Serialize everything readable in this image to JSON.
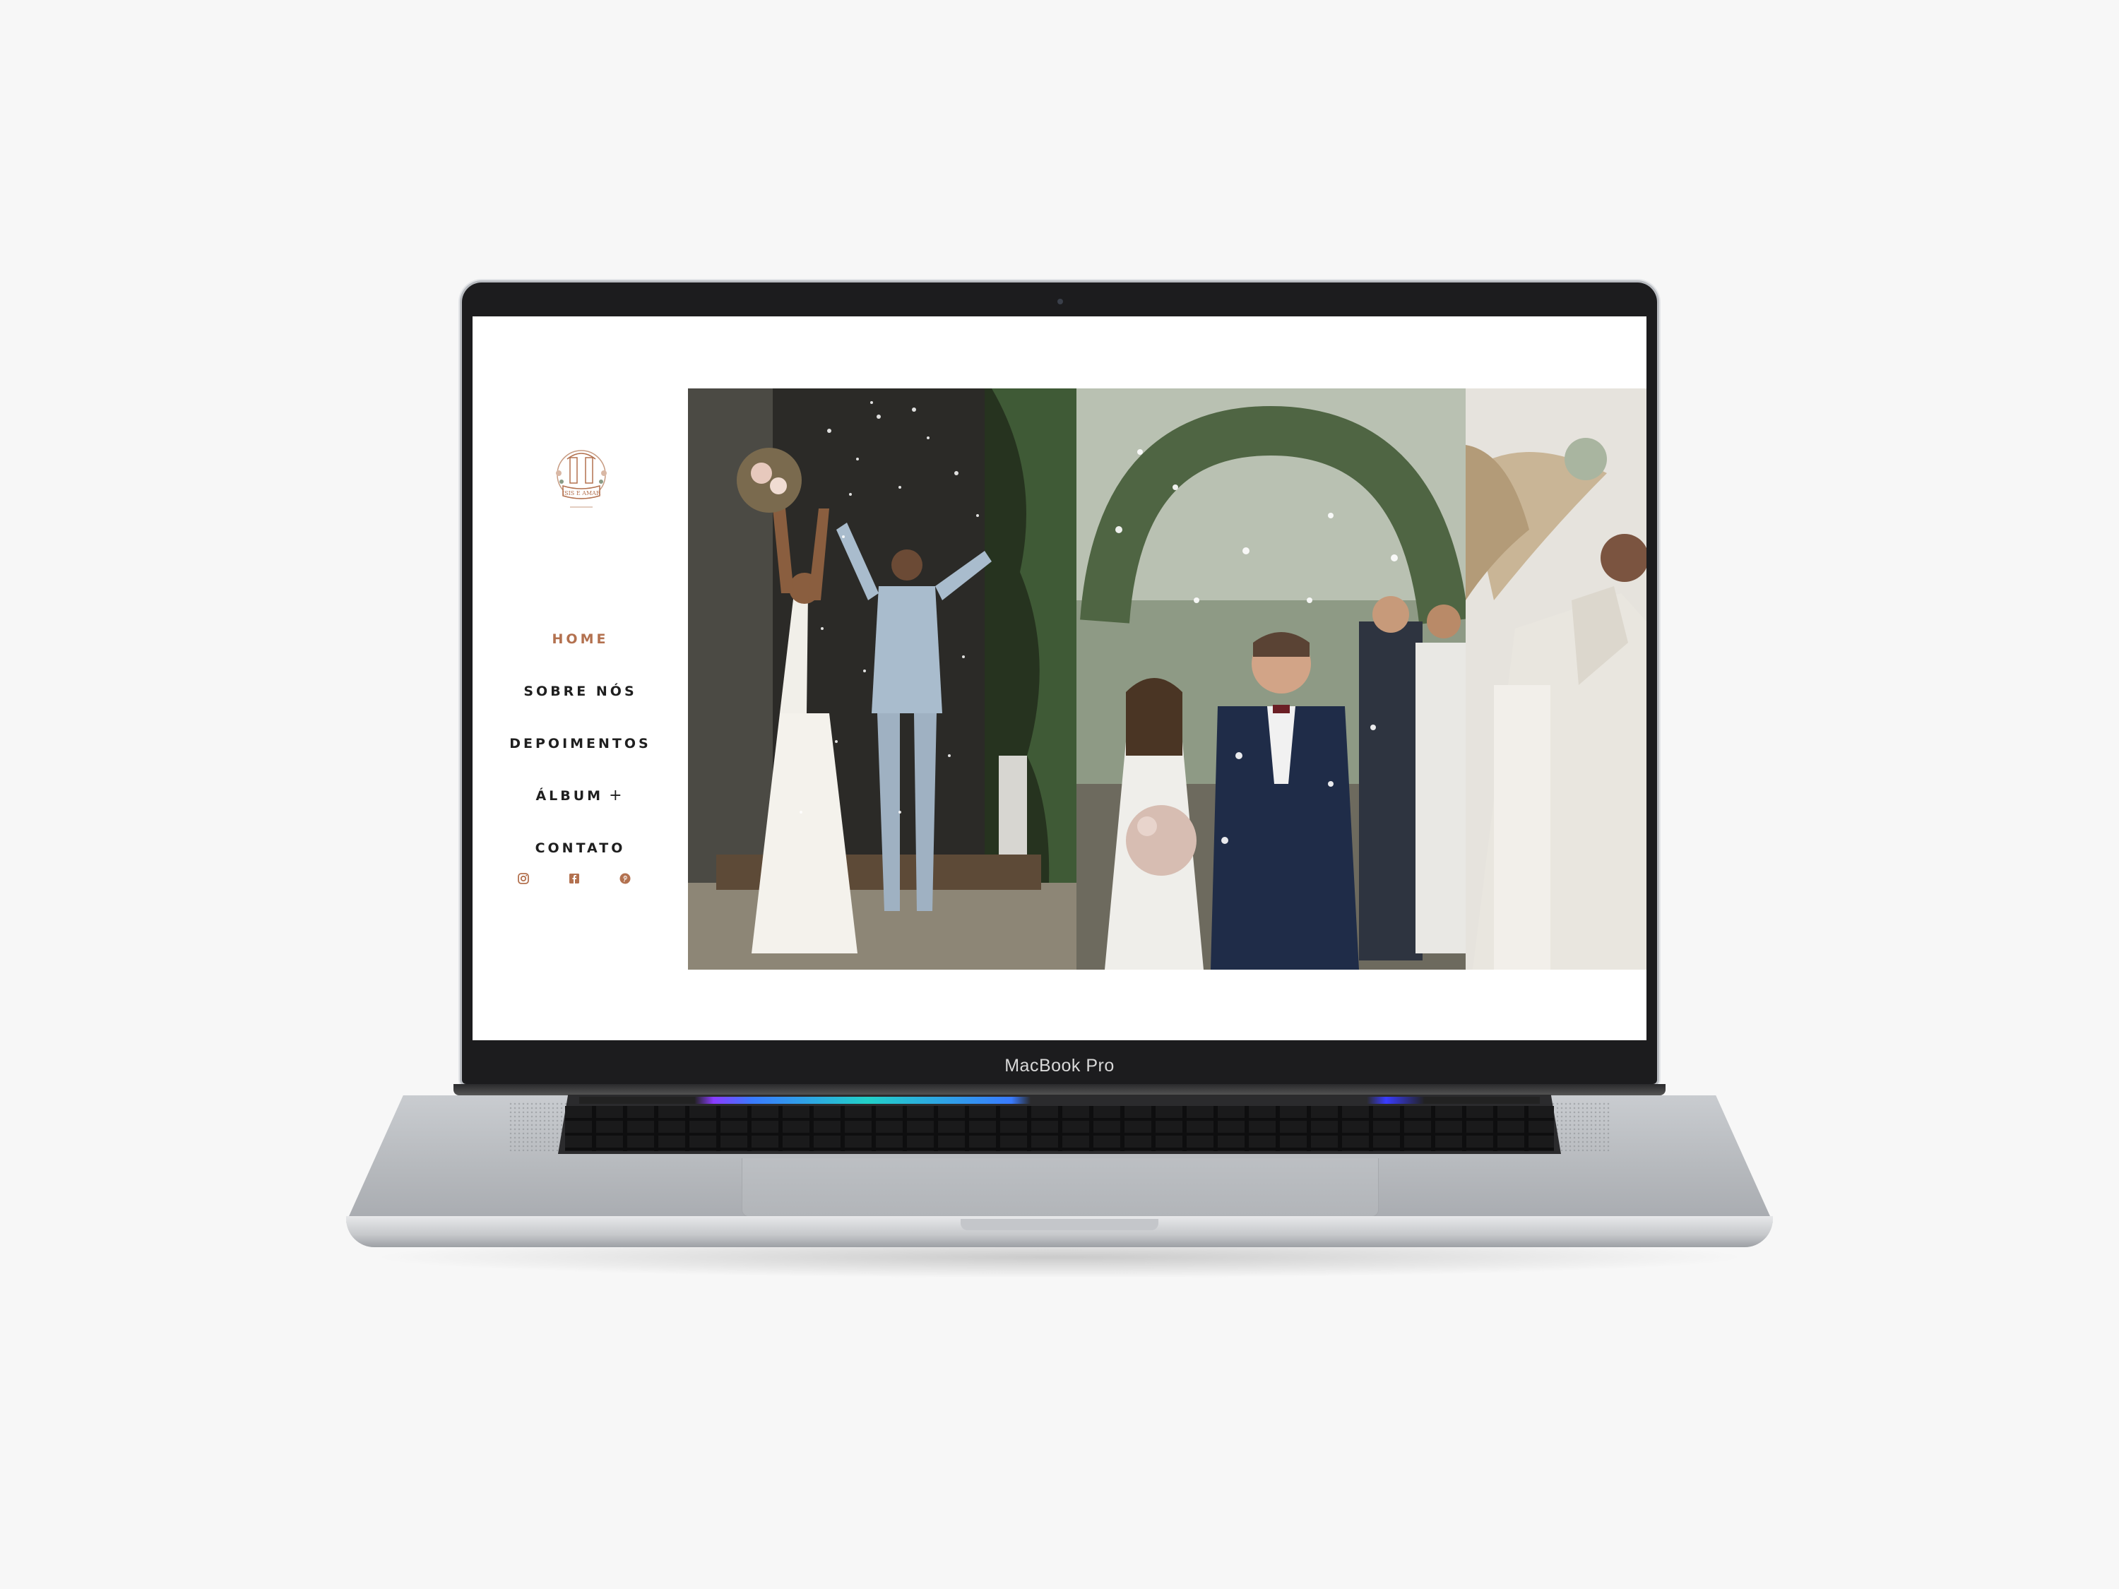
{
  "device": {
    "brand_label": "MacBook Pro"
  },
  "site": {
    "logo_text": "ÍSIS E AMAR",
    "accent_color": "#b3714f",
    "nav": [
      {
        "label": "HOME",
        "active": true
      },
      {
        "label": "SOBRE NÓS",
        "active": false
      },
      {
        "label": "DEPOIMENTOS",
        "active": false
      },
      {
        "label": "ÁLBUM",
        "has_submenu": true,
        "submenu_icon": "plus"
      },
      {
        "label": "CONTATO",
        "active": false
      }
    ],
    "social": [
      {
        "icon": "instagram-icon"
      },
      {
        "icon": "facebook-icon"
      },
      {
        "icon": "pinterest-icon"
      }
    ]
  },
  "gallery": {
    "photos": [
      {
        "subject": "couple-exit-confetti-church"
      },
      {
        "subject": "couple-laughing-petals-garden"
      },
      {
        "subject": "groom-cream-suit-partial"
      }
    ]
  }
}
